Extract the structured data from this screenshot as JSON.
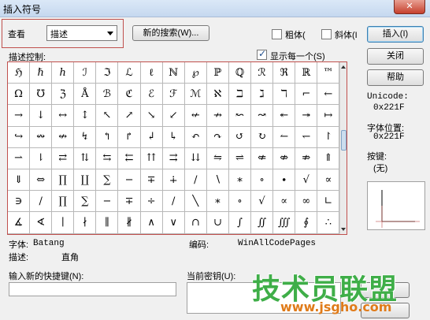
{
  "window": {
    "title": "插入符号",
    "close_label": "✕"
  },
  "view": {
    "label": "查看",
    "select_value": "描述"
  },
  "new_search_button": "新的搜索(W)...",
  "bold": {
    "label": "粗体("
  },
  "italic": {
    "label": "斜体(I"
  },
  "insert_button": "插入(I)",
  "close_button": "关闭",
  "help_button": "帮助",
  "description_control_label": "描述控制:",
  "show_each": {
    "label": "显示每一个(S)",
    "checked": true
  },
  "symbols": [
    [
      "ℌ",
      "ℏ",
      "ℎ",
      "ℐ",
      "ℑ",
      "ℒ",
      "ℓ",
      "ℕ",
      "℘",
      "ℙ",
      "ℚ",
      "ℛ",
      "ℜ",
      "ℝ",
      "™",
      "ℤ"
    ],
    [
      "Ω",
      "℧",
      "ℨ",
      "Å",
      "ℬ",
      "ℭ",
      "ℰ",
      "ℱ",
      "ℳ",
      "ℵ",
      "ℶ",
      "ℷ",
      "ℸ",
      "⌐",
      "←",
      "↑"
    ],
    [
      "→",
      "↓",
      "↔",
      "↕",
      "↖",
      "↗",
      "↘",
      "↙",
      "↚",
      "↛",
      "↜",
      "↝",
      "↞",
      "↠",
      "↦",
      "↩"
    ],
    [
      "↪",
      "↭",
      "↮",
      "↯",
      "↰",
      "↱",
      "↲",
      "↳",
      "↶",
      "↷",
      "↺",
      "↻",
      "↼",
      "↽",
      "↾",
      "↿"
    ],
    [
      "⇀",
      "⇂",
      "⇄",
      "⇅",
      "⇆",
      "⇇",
      "⇈",
      "⇉",
      "⇊",
      "⇋",
      "⇌",
      "⇍",
      "⇎",
      "⇏",
      "⇑",
      "⇒"
    ],
    [
      "⇓",
      "⇔",
      "∏",
      "∐",
      "∑",
      "−",
      "∓",
      "∔",
      "∕",
      "∖",
      "∗",
      "∘",
      "∙",
      "√",
      "∝",
      "∞"
    ],
    [
      "∋",
      "∕",
      "∏",
      "∑",
      "−",
      "∓",
      "÷",
      "/",
      "╲",
      "∗",
      "∘",
      "√",
      "∝",
      "∞",
      "∟",
      "∠"
    ],
    [
      "∡",
      "∢",
      "∣",
      "∤",
      "∥",
      "∦",
      "∧",
      "∨",
      "∩",
      "∪",
      "∫",
      "∬",
      "∭",
      "∮",
      "∴",
      "∵"
    ]
  ],
  "unicode_label": "Unicode:",
  "unicode_value": "0x221F",
  "font_position_label": "字体位置:",
  "font_position_value": "0x221F",
  "keystroke_label": "按键:",
  "keystroke_value": "(无)",
  "font_label": "字体:",
  "font_value": "Batang",
  "encoding_label": "编码:",
  "encoding_value": "WinAllCodePages",
  "description_label": "描述:",
  "description_value": "直角",
  "new_shortcut_label": "输入新的快捷键(N):",
  "current_key_label": "当前密钥(U):",
  "watermark": {
    "main": "技术员联盟",
    "url": "www.jsgho.com"
  }
}
